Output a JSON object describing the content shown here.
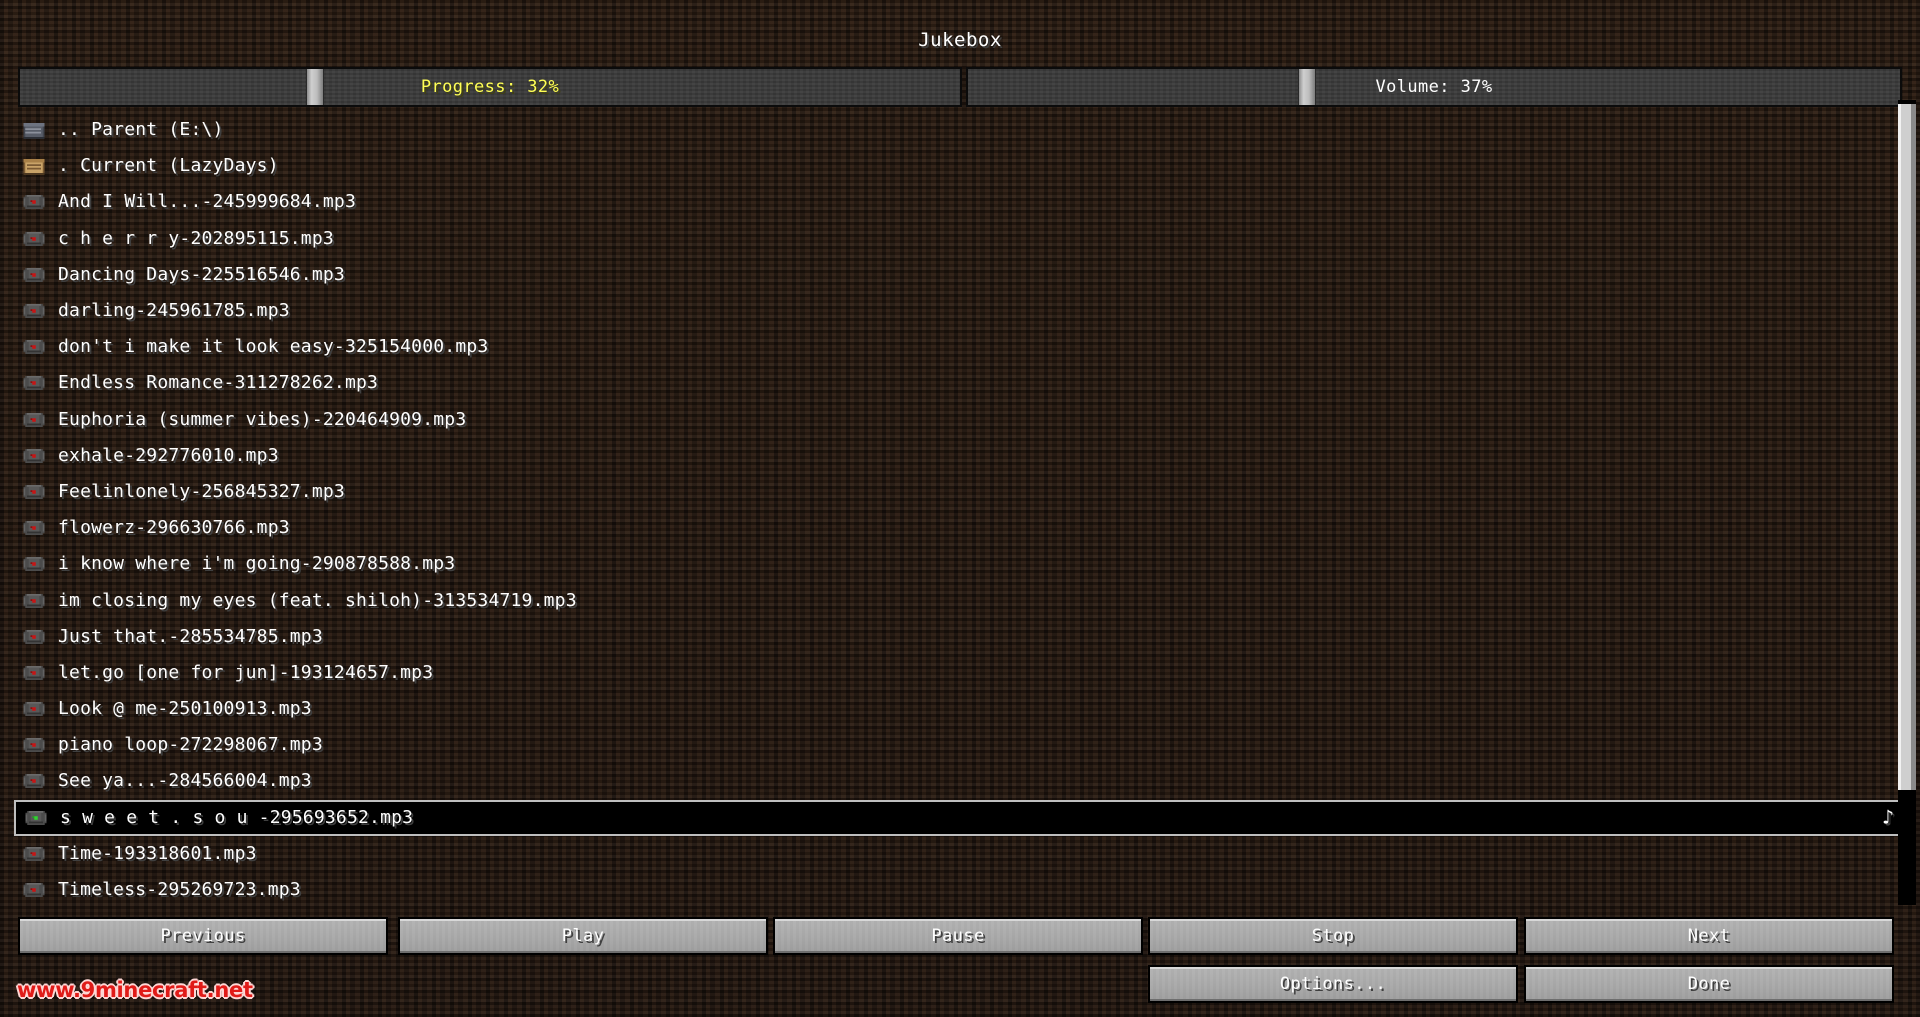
{
  "window": {
    "title": "Jukebox"
  },
  "sliders": {
    "progress": {
      "label": "Progress: 32%",
      "value_pct": 32,
      "handle_left_pct": 31,
      "color": "#ffff55"
    },
    "volume": {
      "label": "Volume: 37%",
      "value_pct": 37,
      "handle_left_pct": 36,
      "color": "#ffffff"
    }
  },
  "file_list": {
    "selected_index": 19,
    "selected_marker": "♪",
    "items": [
      {
        "label": ".. Parent (E:\\)",
        "icon": "folder-parent-icon"
      },
      {
        "label": ". Current (LazyDays)",
        "icon": "folder-current-icon"
      },
      {
        "label": "And I Will...-245999684.mp3",
        "icon": "music-disc-icon"
      },
      {
        "label": "c h e r r y-202895115.mp3",
        "icon": "music-disc-icon"
      },
      {
        "label": "Dancing Days-225516546.mp3",
        "icon": "music-disc-icon"
      },
      {
        "label": "darling-245961785.mp3",
        "icon": "music-disc-icon"
      },
      {
        "label": "don't i make it look easy-325154000.mp3",
        "icon": "music-disc-icon"
      },
      {
        "label": "Endless Romance-311278262.mp3",
        "icon": "music-disc-icon"
      },
      {
        "label": "Euphoria (summer vibes)-220464909.mp3",
        "icon": "music-disc-icon"
      },
      {
        "label": "exhale-292776010.mp3",
        "icon": "music-disc-icon"
      },
      {
        "label": "Feelinlonely-256845327.mp3",
        "icon": "music-disc-icon"
      },
      {
        "label": "flowerz-296630766.mp3",
        "icon": "music-disc-icon"
      },
      {
        "label": "i know where i'm going-290878588.mp3",
        "icon": "music-disc-icon"
      },
      {
        "label": "im closing my eyes (feat. shiloh)-313534719.mp3",
        "icon": "music-disc-icon"
      },
      {
        "label": "Just that.-285534785.mp3",
        "icon": "music-disc-icon"
      },
      {
        "label": "let.go [one for jun]-193124657.mp3",
        "icon": "music-disc-icon"
      },
      {
        "label": "Look @ me-250100913.mp3",
        "icon": "music-disc-icon"
      },
      {
        "label": "piano loop-272298067.mp3",
        "icon": "music-disc-icon"
      },
      {
        "label": "See ya...-284566004.mp3",
        "icon": "music-disc-icon"
      },
      {
        "label": "s w e e t . s o u -295693652.mp3",
        "icon": "music-disc-playing-icon"
      },
      {
        "label": "Time-193318601.mp3",
        "icon": "music-disc-icon"
      },
      {
        "label": "Timeless-295269723.mp3",
        "icon": "music-disc-icon"
      }
    ]
  },
  "controls": {
    "previous": "Previous",
    "play": "Play",
    "pause": "Pause",
    "stop": "Stop",
    "next": "Next",
    "options": "Options...",
    "done": "Done"
  },
  "watermark": {
    "text": "www.9minecraft.net"
  }
}
